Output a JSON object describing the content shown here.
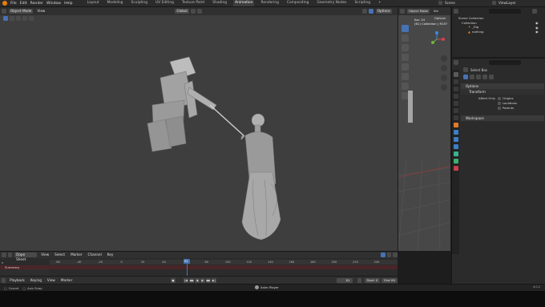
{
  "menubar": {
    "menus": [
      "File",
      "Edit",
      "Render",
      "Window",
      "Help"
    ],
    "workspaces": [
      "Layout",
      "Modeling",
      "Sculpting",
      "UV Editing",
      "Texture Paint",
      "Shading",
      "Animation",
      "Rendering",
      "Compositing",
      "Geometry Nodes",
      "Scripting"
    ],
    "active_workspace": "Animation",
    "scene": "Scene",
    "view_layer": "ViewLayer"
  },
  "viewport": {
    "mode": "Object Mode",
    "view_menu": "View",
    "transform_orientation": "Global",
    "options": "Options"
  },
  "preview": {
    "mode": "Object Mode",
    "view_menu": "Vie",
    "options": "Options",
    "info_line1": "fps: 24",
    "info_line2": "(61) Collection | R15?"
  },
  "outliner": {
    "root": "Scene Collection",
    "collection": "Collection",
    "items": [
      "_Rig",
      "nothing"
    ]
  },
  "properties": {
    "tool_name": "Select Box",
    "options_panel": "Options",
    "transform_subpanel": "Transform",
    "affect_only_label": "Affect Only",
    "affect_only_options": [
      "Origins",
      "Locations",
      "Parents"
    ],
    "workspace_panel": "Workspace"
  },
  "dopesheet": {
    "editor": "Dope Sheet",
    "menus": [
      "View",
      "Select",
      "Marker",
      "Channel",
      "Key"
    ],
    "summary_label": "Summary",
    "ticks": [
      "-60",
      "-40",
      "-20",
      "0",
      "20",
      "40",
      "60",
      "80",
      "100",
      "120",
      "140",
      "160",
      "180",
      "200",
      "220",
      "240"
    ],
    "current_frame": "61"
  },
  "playback": {
    "menus": [
      "Playback",
      "Keying",
      "View",
      "Marker"
    ],
    "frame_field": "61",
    "start_label": "Start",
    "start_value": "0",
    "end_label": "End",
    "end_value": "80"
  },
  "statusbar": {
    "items": [
      "Cancel",
      "Axis Snap"
    ],
    "center_label": "Anim Player",
    "version": "4.0.2"
  },
  "colors": {
    "accent": "#4772b3",
    "logo": "#e87d0d",
    "summary_row": "#4a2528"
  }
}
